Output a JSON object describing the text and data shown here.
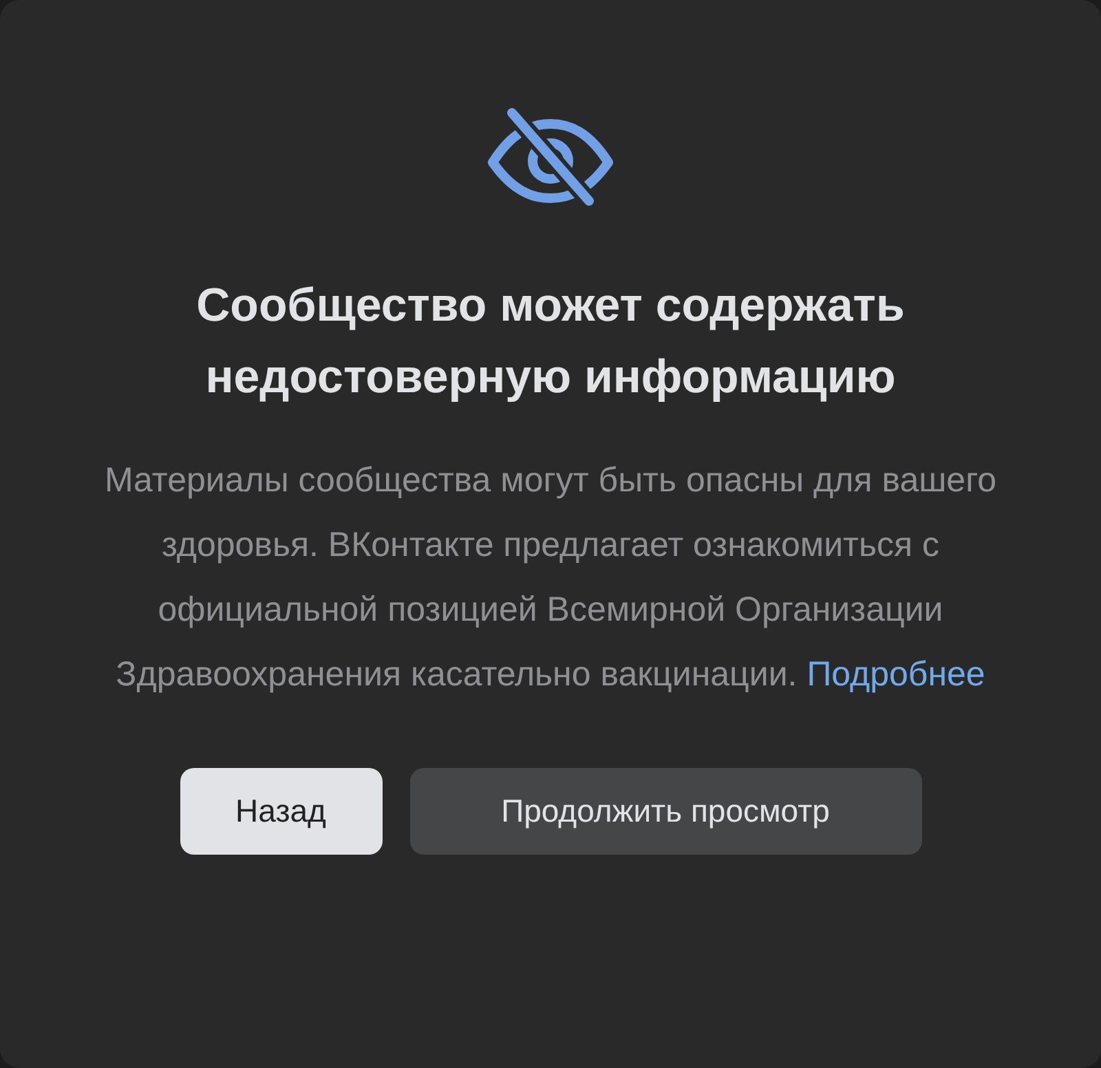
{
  "title": "Сообщество может содержать недостоверную информацию",
  "description": "Материалы сообщества могут быть опасны для вашего здоровья. ВКонтакте предлагает ознакомиться с официальной позицией Всемирной Организации Здравоохранения касательно вакцинации.",
  "link": "Подробнее",
  "buttons": [
    {
      "label": "Назад",
      "kind": "primary"
    },
    {
      "label": "Продолжить просмотр",
      "kind": "secondary"
    }
  ]
}
